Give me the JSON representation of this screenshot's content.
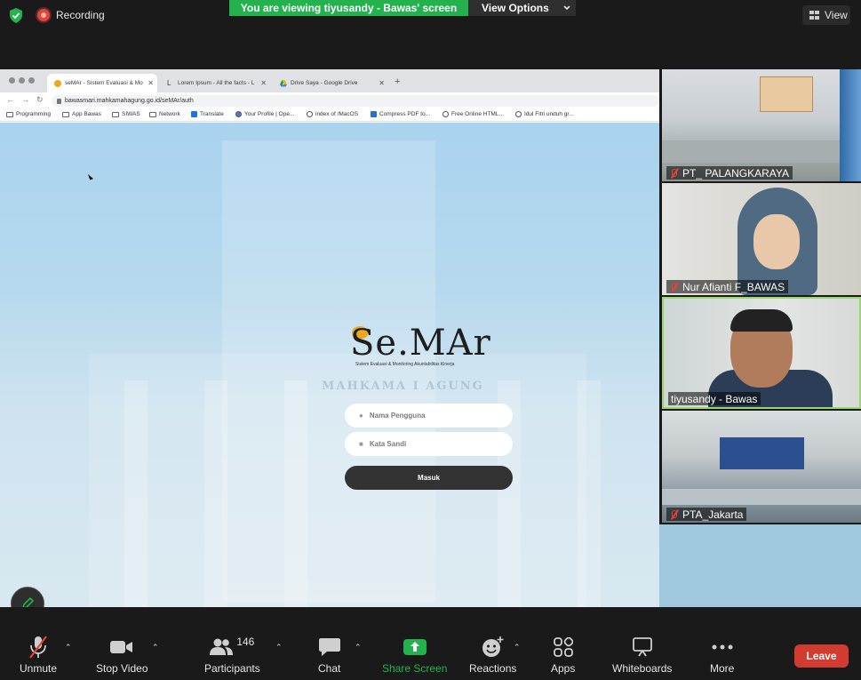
{
  "top_bar": {
    "recording_label": "Recording",
    "viewing_banner": "You are viewing tiyusandy - Bawas' screen",
    "view_options_label": "View Options",
    "view_label": "View"
  },
  "browser": {
    "tabs": [
      {
        "title": "seMAr - Sistem Evaluasi & Mo"
      },
      {
        "title": "Lorem Ipsum - All the facts - L"
      },
      {
        "title": "Drive Saya - Google Drive"
      }
    ],
    "url": "bawasmari.mahkamahagung.go.id/seMAr/auth",
    "bookmarks": [
      "Programming",
      "App Bawas",
      "SIWAS",
      "Network",
      "Translate",
      "Your Profile | Ope...",
      "index of /MacOS",
      "Compress PDF to...",
      "Free Online HTML...",
      "Idul Fitri unduh gr..."
    ]
  },
  "login": {
    "logo_text": "Se.MAr",
    "logo_subtitle": "Sistem Evaluasi & Monitoring Akuntabilitas Kinerja",
    "username_placeholder": "Nama Pengguna",
    "password_placeholder": "Kata Sandi",
    "submit_label": "Masuk",
    "building_text": "MAHKAMA I AGUNG"
  },
  "participants": [
    {
      "name": "PT_ PALANGKARAYA",
      "muted": true
    },
    {
      "name": "Nur Afianti F_BAWAS",
      "muted": true
    },
    {
      "name": "tiyusandy - Bawas",
      "muted": false
    },
    {
      "name": "PTA_Jakarta",
      "muted": true
    }
  ],
  "toolbar": {
    "unmute": "Unmute",
    "stop_video": "Stop Video",
    "participants": "Participants",
    "participants_count": "146",
    "chat": "Chat",
    "share_screen": "Share Screen",
    "reactions": "Reactions",
    "apps": "Apps",
    "whiteboards": "Whiteboards",
    "more": "More",
    "leave": "Leave"
  },
  "colors": {
    "share_green": "#24b24f",
    "leave_red": "#d23b30",
    "muted_red": "#e0443a"
  }
}
